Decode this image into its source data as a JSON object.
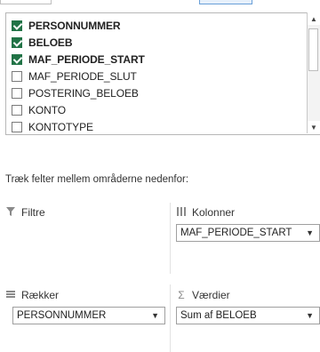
{
  "field_list": {
    "items": [
      {
        "label": "PERSONNUMMER",
        "checked": true
      },
      {
        "label": "BELOEB",
        "checked": true
      },
      {
        "label": "MAF_PERIODE_START",
        "checked": true
      },
      {
        "label": "MAF_PERIODE_SLUT",
        "checked": false
      },
      {
        "label": "POSTERING_BELOEB",
        "checked": false
      },
      {
        "label": "KONTO",
        "checked": false
      },
      {
        "label": "KONTOTYPE",
        "checked": false
      }
    ]
  },
  "instruction": "Træk felter mellem områderne nedenfor:",
  "areas": {
    "filters": {
      "label": "Filtre",
      "icon": "filter-icon"
    },
    "columns": {
      "label": "Kolonner",
      "icon": "columns-icon",
      "field": "MAF_PERIODE_START"
    },
    "rows": {
      "label": "Rækker",
      "icon": "rows-icon",
      "field": "PERSONNUMMER"
    },
    "values": {
      "label": "Værdier",
      "icon": "sigma-icon",
      "field": "Sum af BELOEB"
    }
  },
  "colors": {
    "checkbox_checked": "#217346",
    "border": "#b7b7b7"
  }
}
